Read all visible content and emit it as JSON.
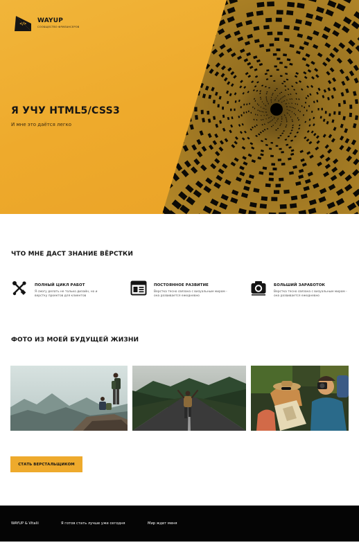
{
  "header": {
    "logo_title": "WAYUP",
    "logo_subtitle": "СООБЩЕСТВО ФРИЛАНСЕРОВ",
    "logo_code": "</>"
  },
  "hero": {
    "title": "Я УЧУ HTML5/CSS3",
    "subtitle": "И мне это даётся легко"
  },
  "features_section": {
    "title": "ЧТО МНЕ ДАСТ ЗНАНИЕ ВЁРСТКИ",
    "items": [
      {
        "icon": "tools-icon",
        "title": "ПОЛНЫЙ ЦИКЛ РАБОТ",
        "description": "Я смогу делать не только дизайн, но и верстку проектов для клиентов"
      },
      {
        "icon": "browser-window-icon",
        "title": "ПОСТОЯННОЕ РАЗВИТИЕ",
        "description": "Верстка тесно связана с визуальным миром - она развивается ежедневно"
      },
      {
        "icon": "camera-icon",
        "title": "БОЛЬШИЙ ЗАРАБОТОК",
        "description": "Верстка тесно связана с визуальным миром - она развивается ежедневно"
      }
    ]
  },
  "photos_section": {
    "title": "ФОТО ИЗ МОЕЙ БУДУЩЕЙ ЖИЗНИ",
    "photos": [
      "hikers-on-mountain-photo",
      "traveler-on-road-photo",
      "travelers-with-map-photo"
    ]
  },
  "cta": {
    "label": "СТАТЬ ВЕРСТАЛЬЩИКОМ"
  },
  "footer": {
    "items": [
      "WAYUP & Vitalii",
      "Я готов стать лучше уже сегодня",
      "Мир ждет меня"
    ]
  },
  "colors": {
    "accent": "#eeaa2c",
    "dark": "#151515",
    "footer_bg": "#050505"
  }
}
